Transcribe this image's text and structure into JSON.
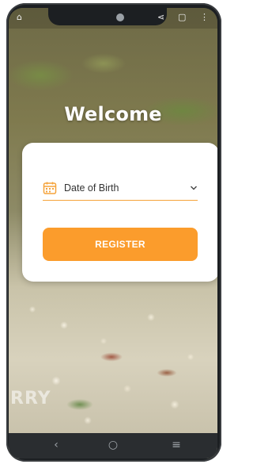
{
  "screen": {
    "title": "Welcome",
    "watermark": "RRY"
  },
  "status_bar": {
    "left_icon": "⌂",
    "share_icon": "⋖",
    "battery_icon": "▢",
    "menu_icon": "⋮"
  },
  "form": {
    "dob_label": "Date of Birth",
    "register_label": "REGISTER"
  },
  "nav_bar": {
    "back_icon": "‹",
    "home_icon": "○",
    "recents_icon": "≡"
  },
  "colors": {
    "accent": "#fb9c2c",
    "underline": "#f5a33a",
    "card": "#ffffff"
  }
}
